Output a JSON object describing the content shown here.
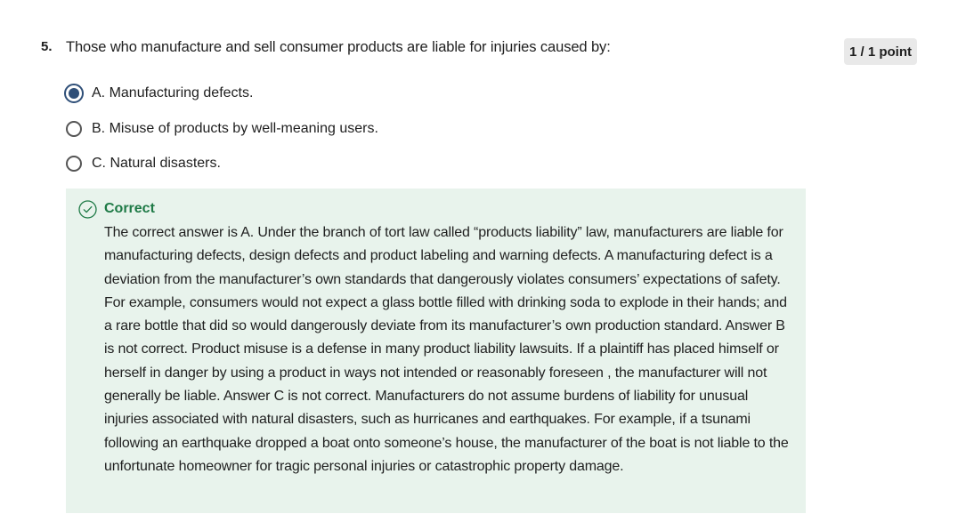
{
  "question": {
    "number": "5.",
    "prompt": "Those who manufacture and sell consumer products are liable for injuries caused by:",
    "score": "1 / 1 point"
  },
  "options": [
    {
      "label": "A. Manufacturing defects.",
      "selected": true
    },
    {
      "label": "B. Misuse of products by well-meaning users.",
      "selected": false
    },
    {
      "label": "C. Natural disasters.",
      "selected": false
    }
  ],
  "feedback": {
    "status": "Correct",
    "icon": "check-circle-icon",
    "status_color": "#1e7a46",
    "background_color": "#e8f3ec",
    "explanation": "The correct answer is A.  Under the branch of tort law called “products liability” law, manufacturers are liable for manufacturing defects, design defects and product labeling and warning defects.  A manufacturing defect is a deviation from the manufacturer’s own standards that dangerously violates consumers’ expectations of safety.  For example, consumers would not expect a glass bottle filled with drinking soda to explode in their hands; and a rare bottle that did so would dangerously deviate from its manufacturer’s own production standard. Answer  B is not correct.  Product misuse is a defense in many product liability lawsuits.  If a plaintiff has placed himself or herself in danger by using a product in ways not intended or reasonably foreseen , the manufacturer will not generally be liable.  Answer C is not correct. Manufacturers do not assume burdens of liability for unusual injuries associated with natural disasters, such as hurricanes and earthquakes. For example, if a tsunami following an earthquake dropped a boat onto someone’s house, the manufacturer of the boat is not liable to the unfortunate homeowner for  tragic personal injuries or catastrophic property damage."
  },
  "colors": {
    "radio_selected": "#2f4f78",
    "badge_background": "#e9e9e9"
  }
}
